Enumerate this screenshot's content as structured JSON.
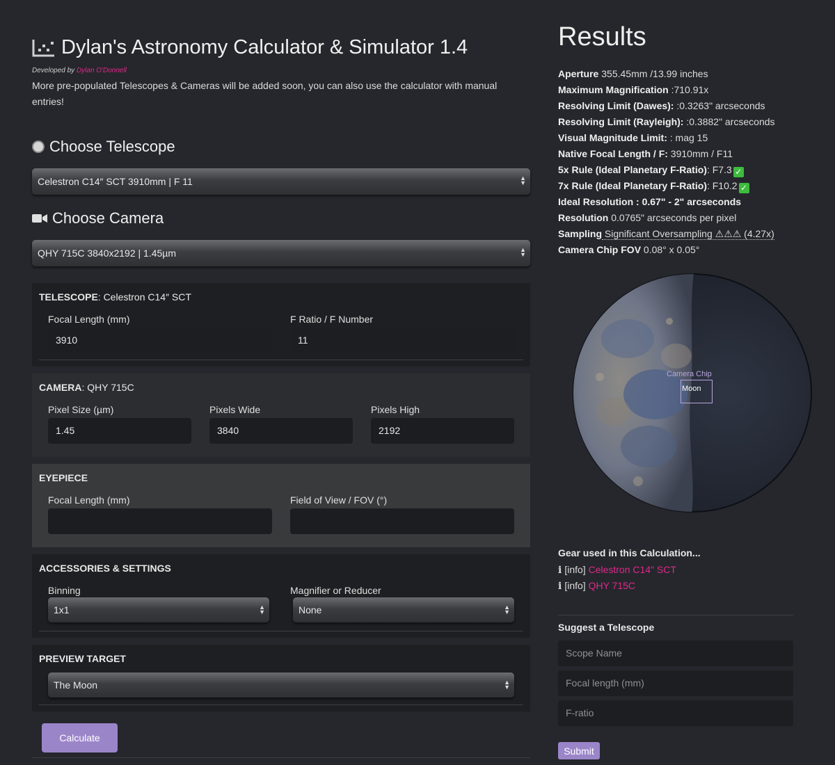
{
  "header": {
    "title": "Dylan's Astronomy Calculator & Simulator 1.4",
    "developed_by_prefix": "Developed by",
    "developer_name": "Dylan O'Donnell",
    "intro": "More pre-populated Telescopes & Cameras will be added soon, you can also use the calculator with manual entries!"
  },
  "telescope_select": {
    "heading": "Choose Telescope",
    "selected": "Celestron C14″ SCT 3910mm | F 11"
  },
  "camera_select": {
    "heading": "Choose Camera",
    "selected": "QHY 715C 3840x2192 | 1.45µm"
  },
  "telescope_panel": {
    "label": "TELESCOPE",
    "name": ": Celestron C14″ SCT",
    "focal_length_label": "Focal Length (mm)",
    "focal_length_value": "3910",
    "f_ratio_label": "F Ratio / F Number",
    "f_ratio_value": "11"
  },
  "camera_panel": {
    "label": "CAMERA",
    "name": ": QHY 715C",
    "pixel_size_label": "Pixel Size (µm)",
    "pixel_size_value": "1.45",
    "pixels_wide_label": "Pixels Wide",
    "pixels_wide_value": "3840",
    "pixels_high_label": "Pixels High",
    "pixels_high_value": "2192"
  },
  "eyepiece_panel": {
    "label": "EYEPIECE",
    "focal_length_label": "Focal Length (mm)",
    "fov_label": "Field of View / FOV (°)"
  },
  "accessories_panel": {
    "label": "ACCESSORIES & SETTINGS",
    "binning_label": "Binning",
    "binning_value": "1x1",
    "magnifier_label": "Magnifier or Reducer",
    "magnifier_value": "None"
  },
  "preview_panel": {
    "label": "PREVIEW TARGET",
    "target_value": "The Moon"
  },
  "calculate_label": "Calculate",
  "results": {
    "title": "Results",
    "aperture_label": "Aperture",
    "aperture_value": " 355.45mm /13.99 inches",
    "max_mag_label": "Maximum Magnification",
    "max_mag_value": " :710.91x",
    "dawes_label": "Resolving Limit (Dawes):",
    "dawes_value": " :0.3263\" arcseconds",
    "rayleigh_label": "Resolving Limit (Rayleigh):",
    "rayleigh_value": " :0.3882\" arcseconds",
    "vis_mag_label": "Visual Magnitude Limit:",
    "vis_mag_value": " : mag 15",
    "native_fl_label": "Native Focal Length / F:",
    "native_fl_value": " 3910mm / F11",
    "rule5_label": "5x Rule (Ideal Planetary F-Ratio)",
    "rule5_value": ": F7.3",
    "rule7_label": "7x Rule (Ideal Planetary F-Ratio)",
    "rule7_value": ": F10.2",
    "ideal_res_label": "Ideal Resolution : 0.67\" - 2\" arcseconds",
    "resolution_label": "Resolution",
    "resolution_value": " 0.0765\" arcseconds per pixel",
    "sampling_label": "Sampling",
    "sampling_value": " Significant Oversampling ⚠⚠⚠ (4.27x)",
    "chip_fov_label": "Camera Chip FOV",
    "chip_fov_value": " 0.08° x 0.05°"
  },
  "preview": {
    "chip_label": "Camera Chip",
    "target_label": "Moon"
  },
  "gear": {
    "title": "Gear used in this Calculation...",
    "info_prefix": "[info]",
    "telescope_link": "Celestron C14\" SCT",
    "camera_link": "QHY 715C"
  },
  "suggest": {
    "title": "Suggest a Telescope",
    "scope_placeholder": "Scope Name",
    "focal_placeholder": "Focal length (mm)",
    "fratio_placeholder": "F-ratio",
    "submit_label": "Submit"
  },
  "colors": {
    "background": "#25272c",
    "accent_purple": "#9b85c9",
    "link_pink": "#e0288a",
    "check_green": "#3dbb3d"
  },
  "icons": [
    "scatter-chart-icon",
    "radio-icon",
    "video-camera-icon",
    "select-arrows-icon",
    "check-icon",
    "info-icon"
  ]
}
